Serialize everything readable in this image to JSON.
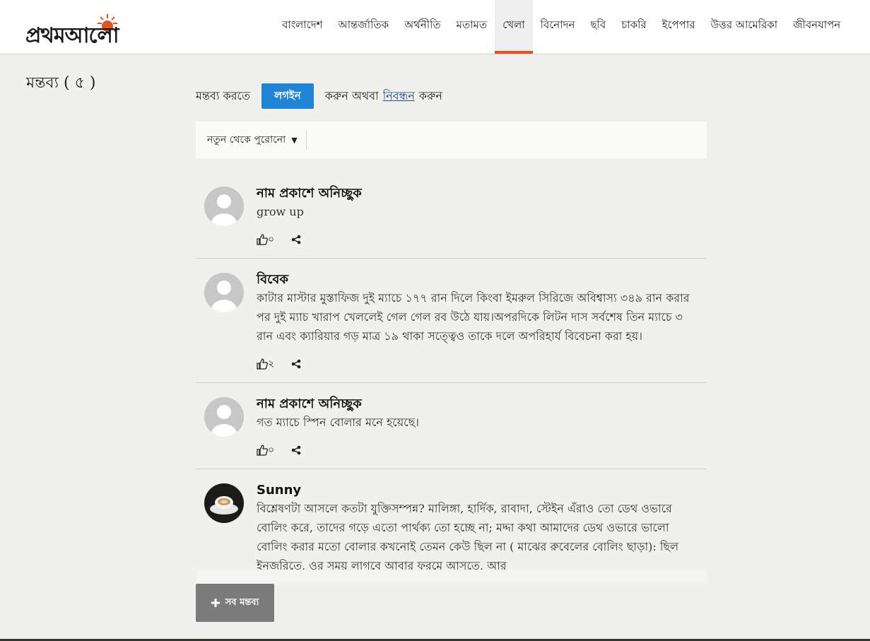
{
  "logo": {
    "text": "প্রথমআলো"
  },
  "nav": [
    {
      "label": "বাংলাদেশ"
    },
    {
      "label": "আন্তর্জাতিক"
    },
    {
      "label": "অর্থনীতি"
    },
    {
      "label": "মতামত"
    },
    {
      "label": "খেলা",
      "active": true
    },
    {
      "label": "বিনোদন"
    },
    {
      "label": "ছবি"
    },
    {
      "label": "চাকরি"
    },
    {
      "label": "ইপেপার"
    },
    {
      "label": "উত্তর আমেরিকা"
    },
    {
      "label": "জীবনযাপন"
    }
  ],
  "comments_heading": "মন্তব্য ( ৫ )",
  "login": {
    "prefix": "মন্তব্য করতে",
    "button": "লগইন",
    "middle": "করুন অথবা",
    "register_link": "নিবন্ধন",
    "suffix": "করুন"
  },
  "sort": {
    "selected": "নতুন থেকে পুরোনো"
  },
  "comments": [
    {
      "name": "নাম প্রকাশে অনিচ্ছুক",
      "text": "grow up",
      "likes": "০",
      "avatar": "default-avatar-icon"
    },
    {
      "name": "বিবেক",
      "text": "কাটার মাস্টার মুস্তাফিজ দুই ম্যাচে ১৭৭ রান দিলে কিংবা ইমরুল সিরিজে অবিশ্বাস্য  ৩৪৯ রান করার পর দুই ম্যাচ খারাপ খেললেই গেল গেল রব উঠে যায়।অপরদিকে  লিটন দাস সর্বশেষ তিন ম্যাচে ৩ রান এবং ক্যারিয়ার গড় মাত্র ১৯ থাকা সত্ত্বেও তাকে দলে অপরিহার্য বিবেচনা করা হয়।",
      "likes": "২",
      "avatar": "default-avatar-icon"
    },
    {
      "name": "নাম প্রকাশে অনিচ্ছুক",
      "text": "গত ম্যাচে স্পিন বোলার মনে হয়েছে।",
      "likes": "০",
      "avatar": "default-avatar-icon"
    },
    {
      "name": "Sunny",
      "text": "বিশ্লেষণটা আসলে কতটা যুক্তিসম্পন্ন? মালিঙ্গা, হার্দিক, রাবাদা, স্টেইন  এঁরাও তো ডেথ ওভারে বোলিং করে, তাদের গড়ে এতো পার্থক্য তো হচ্ছে না; মদ্দা কথা আমাদের ডেথ ওভারে ভালো বোলিং করার মতো বোলার কখনোই তেমন কেউ ছিল না ( মাঝের রুবেলের বোলিং ছাড়া): ছিল ইনজরিতে, ওর সময় লাগবে আবার ফরমে আসতে, আর",
      "likes": "",
      "avatar": "coffee-cup-avatar"
    }
  ],
  "all_comments_button": "সব মন্তব্য",
  "colors": {
    "accent": "#e2541f",
    "login_button": "#2084d6",
    "all_button": "#7b7b7b"
  }
}
